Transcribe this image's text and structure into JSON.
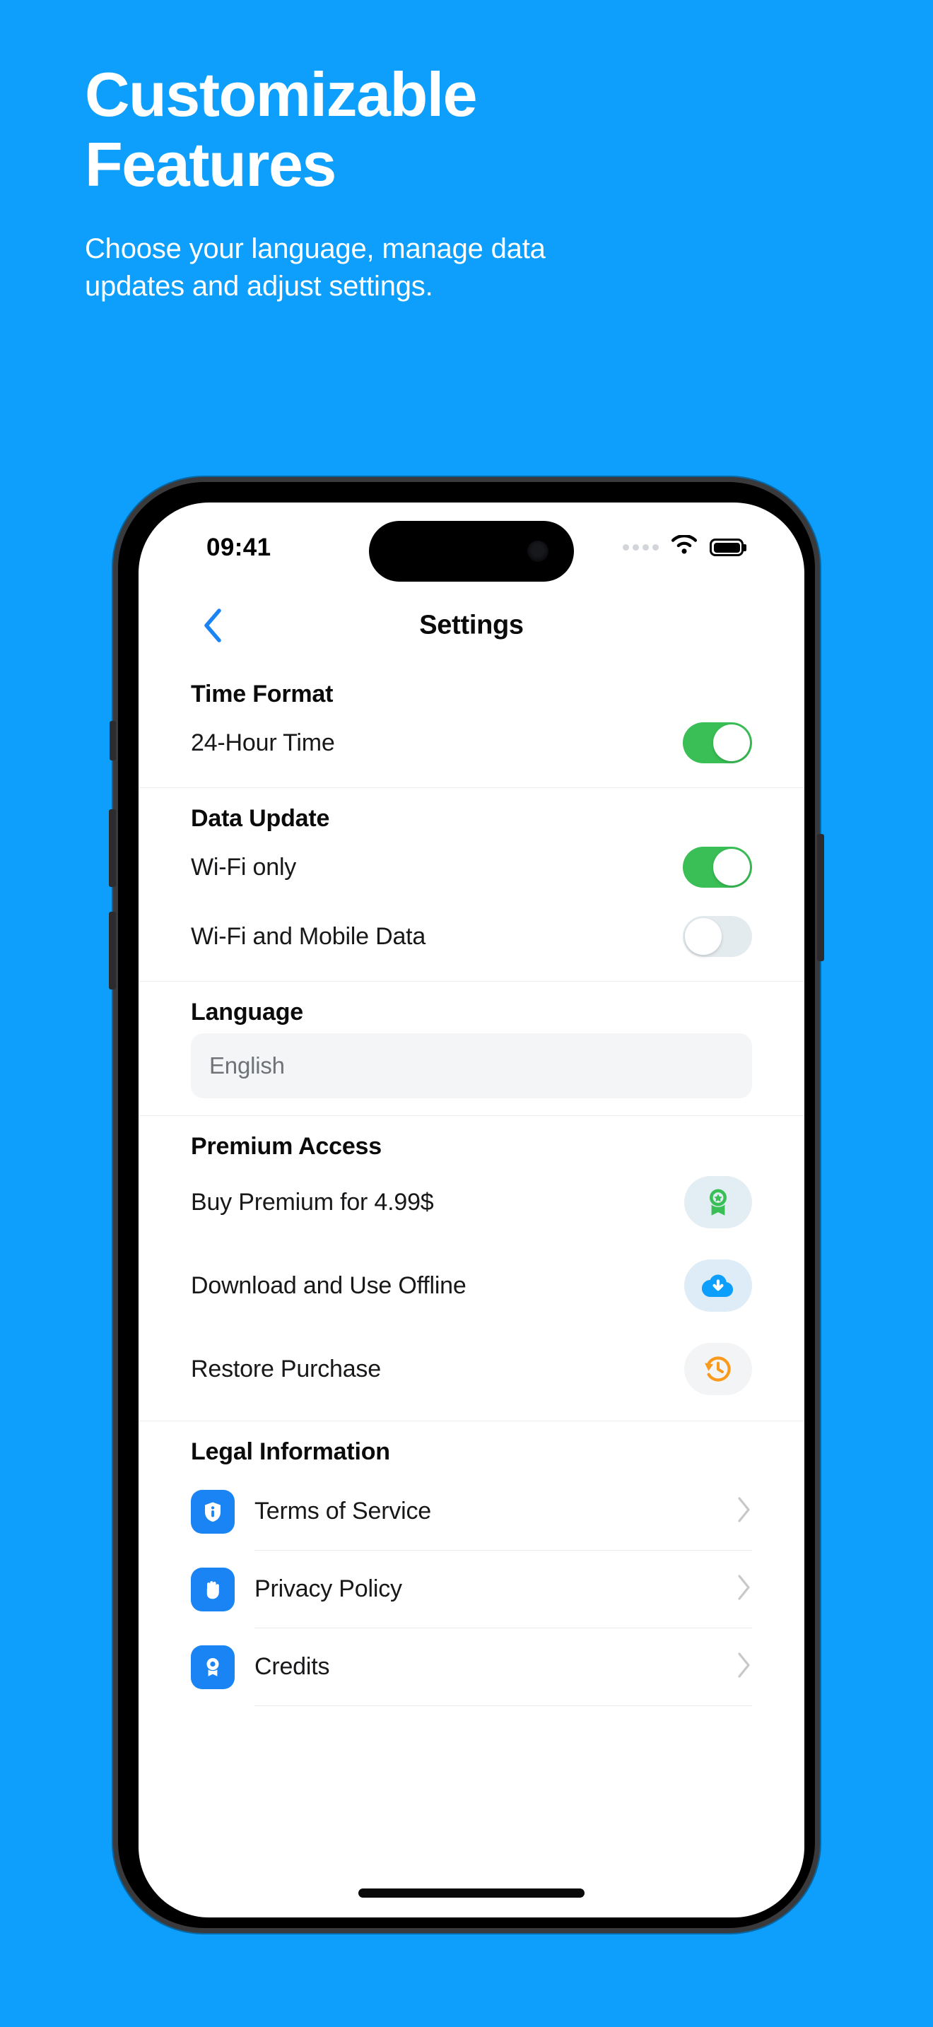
{
  "promo": {
    "title": "Customizable\nFeatures",
    "subtitle": "Choose your language, manage data\nupdates and adjust settings.",
    "background_color": "#0D9FFB",
    "text_color": "#FFFFFF"
  },
  "phone": {
    "status_bar": {
      "time": "09:41",
      "signal_icon": "signal-dots-icon",
      "wifi_icon": "wifi-icon",
      "battery_icon": "battery-icon"
    },
    "nav": {
      "back_icon": "chevron-left-icon",
      "title": "Settings",
      "back_color": "#1A84F5"
    },
    "home_indicator": "home-indicator"
  },
  "sections": [
    {
      "id": "time-format",
      "title": "Time Format",
      "rows": [
        {
          "label": "24-Hour Time",
          "control": "toggle",
          "state": "on"
        }
      ]
    },
    {
      "id": "data-update",
      "title": "Data Update",
      "rows": [
        {
          "label": "Wi-Fi only",
          "control": "toggle",
          "state": "on"
        },
        {
          "label": "Wi-Fi and Mobile Data",
          "control": "toggle",
          "state": "off"
        }
      ]
    },
    {
      "id": "language",
      "title": "Language",
      "field": {
        "value": "English",
        "placeholder": "English"
      }
    },
    {
      "id": "premium-access",
      "title": "Premium Access",
      "rows": [
        {
          "label": "Buy Premium for 4.99$",
          "icon": "medal-star-icon",
          "icon_color": "#3ABF56",
          "pill_color": "#E2EEF3"
        },
        {
          "label": "Download and Use Offline",
          "icon": "cloud-download-icon",
          "icon_color": "#0D9FFB",
          "pill_color": "#DDECF6"
        },
        {
          "label": "Restore Purchase",
          "icon": "clock-restore-icon",
          "icon_color": "#F99A1C",
          "pill_color": "#F3F4F5"
        }
      ]
    },
    {
      "id": "legal-information",
      "title": "Legal Information",
      "rows": [
        {
          "label": "Terms of Service",
          "icon": "shield-info-icon",
          "chevron": "chevron-right-icon"
        },
        {
          "label": "Privacy Policy",
          "icon": "hand-stop-icon",
          "chevron": "chevron-right-icon"
        },
        {
          "label": "Credits",
          "icon": "award-ribbon-icon",
          "chevron": "chevron-right-icon"
        }
      ]
    }
  ],
  "colors": {
    "brand_blue": "#0D9FFB",
    "toggle_on": "#3ABF56",
    "toggle_off": "#E4EBEE",
    "legal_icon_blue": "#1A84F5",
    "orange": "#F99A1C"
  }
}
